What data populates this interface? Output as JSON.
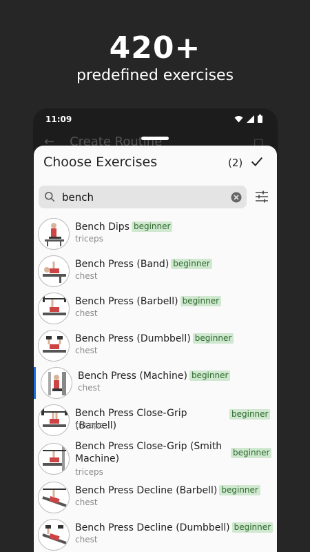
{
  "promo": {
    "title": "420+",
    "subtitle": "predefined exercises"
  },
  "status_bar": {
    "time": "11:09"
  },
  "background_app": {
    "title": "Create Routine"
  },
  "sheet": {
    "title": "Choose Exercises",
    "selected_count": "(2)",
    "search": {
      "value": "bench",
      "placeholder": "Search"
    }
  },
  "exercises": [
    {
      "name": "Bench Dips",
      "level": "beginner",
      "muscle": "triceps",
      "selected": false
    },
    {
      "name": "Bench Press (Band)",
      "level": "beginner",
      "muscle": "chest",
      "selected": false
    },
    {
      "name": "Bench Press (Barbell)",
      "level": "beginner",
      "muscle": "chest",
      "selected": false
    },
    {
      "name": "Bench Press (Dumbbell)",
      "level": "beginner",
      "muscle": "chest",
      "selected": false
    },
    {
      "name": "Bench Press (Machine)",
      "level": "beginner",
      "muscle": "chest",
      "selected": true
    },
    {
      "name": "Bench Press Close-Grip (Barbell)",
      "level": "beginner",
      "muscle": "triceps",
      "selected": false
    },
    {
      "name": "Bench Press Close-Grip (Smith Machine)",
      "level": "beginner",
      "muscle": "triceps",
      "selected": false
    },
    {
      "name": "Bench Press Decline (Barbell)",
      "level": "beginner",
      "muscle": "chest",
      "selected": false
    },
    {
      "name": "Bench Press Decline (Dumbbell)",
      "level": "beginner",
      "muscle": "chest",
      "selected": false
    }
  ],
  "colors": {
    "accent": "#1e6fe0",
    "badge_bg": "#cfe8cf",
    "badge_text": "#2f6a2f"
  }
}
